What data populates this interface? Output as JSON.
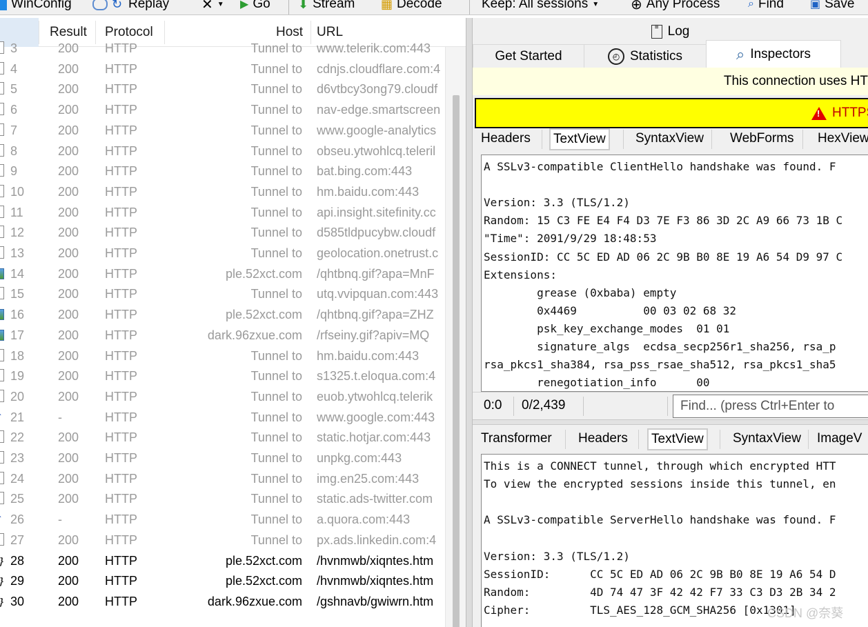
{
  "toolbar": {
    "winconfig": "WinConfig",
    "replay": "Replay",
    "go": "Go",
    "stream": "Stream",
    "decode": "Decode",
    "keep": "Keep: All sessions",
    "process": "Any Process",
    "find": "Find",
    "save": "Save"
  },
  "grid": {
    "headers": {
      "result": "Result",
      "protocol": "Protocol",
      "host": "Host",
      "url": "URL"
    },
    "rows": [
      {
        "icon": "doc",
        "num": "3",
        "result": "200",
        "protocol": "HTTP",
        "host": "Tunnel to",
        "url": "www.telerik.com:443",
        "dark": false
      },
      {
        "icon": "doc",
        "num": "4",
        "result": "200",
        "protocol": "HTTP",
        "host": "Tunnel to",
        "url": "cdnjs.cloudflare.com:4",
        "dark": false
      },
      {
        "icon": "doc",
        "num": "5",
        "result": "200",
        "protocol": "HTTP",
        "host": "Tunnel to",
        "url": "d6vtbcy3ong79.cloudf",
        "dark": false
      },
      {
        "icon": "doc",
        "num": "6",
        "result": "200",
        "protocol": "HTTP",
        "host": "Tunnel to",
        "url": "nav-edge.smartscreen",
        "dark": false
      },
      {
        "icon": "doc",
        "num": "7",
        "result": "200",
        "protocol": "HTTP",
        "host": "Tunnel to",
        "url": "www.google-analytics",
        "dark": false
      },
      {
        "icon": "doc",
        "num": "8",
        "result": "200",
        "protocol": "HTTP",
        "host": "Tunnel to",
        "url": "obseu.ytwohlcq.teleril",
        "dark": false
      },
      {
        "icon": "doc",
        "num": "9",
        "result": "200",
        "protocol": "HTTP",
        "host": "Tunnel to",
        "url": "bat.bing.com:443",
        "dark": false
      },
      {
        "icon": "doc",
        "num": "10",
        "result": "200",
        "protocol": "HTTP",
        "host": "Tunnel to",
        "url": "hm.baidu.com:443",
        "dark": false
      },
      {
        "icon": "doc",
        "num": "11",
        "result": "200",
        "protocol": "HTTP",
        "host": "Tunnel to",
        "url": "api.insight.sitefinity.cc",
        "dark": false
      },
      {
        "icon": "doc",
        "num": "12",
        "result": "200",
        "protocol": "HTTP",
        "host": "Tunnel to",
        "url": "d585tldpucybw.cloudf",
        "dark": false
      },
      {
        "icon": "doc",
        "num": "13",
        "result": "200",
        "protocol": "HTTP",
        "host": "Tunnel to",
        "url": "geolocation.onetrust.c",
        "dark": false
      },
      {
        "icon": "img",
        "num": "14",
        "result": "200",
        "protocol": "HTTP",
        "host": "ple.52xct.com",
        "url": "/qhtbnq.gif?apa=MnF",
        "dark": false
      },
      {
        "icon": "doc",
        "num": "15",
        "result": "200",
        "protocol": "HTTP",
        "host": "Tunnel to",
        "url": "utq.vvipquan.com:443",
        "dark": false
      },
      {
        "icon": "img",
        "num": "16",
        "result": "200",
        "protocol": "HTTP",
        "host": "ple.52xct.com",
        "url": "/qhtbnq.gif?apa=ZHZ",
        "dark": false
      },
      {
        "icon": "img",
        "num": "17",
        "result": "200",
        "protocol": "HTTP",
        "host": "dark.96zxue.com",
        "url": "/rfseiny.gif?apiv=MQ",
        "dark": false
      },
      {
        "icon": "doc",
        "num": "18",
        "result": "200",
        "protocol": "HTTP",
        "host": "Tunnel to",
        "url": "hm.baidu.com:443",
        "dark": false
      },
      {
        "icon": "doc",
        "num": "19",
        "result": "200",
        "protocol": "HTTP",
        "host": "Tunnel to",
        "url": "s1325.t.eloqua.com:4",
        "dark": false
      },
      {
        "icon": "doc",
        "num": "20",
        "result": "200",
        "protocol": "HTTP",
        "host": "Tunnel to",
        "url": "euob.ytwohlcq.telerik",
        "dark": false
      },
      {
        "icon": "up",
        "num": "21",
        "result": "-",
        "protocol": "HTTP",
        "host": "Tunnel to",
        "url": "www.google.com:443",
        "dark": false
      },
      {
        "icon": "doc",
        "num": "22",
        "result": "200",
        "protocol": "HTTP",
        "host": "Tunnel to",
        "url": "static.hotjar.com:443",
        "dark": false
      },
      {
        "icon": "doc",
        "num": "23",
        "result": "200",
        "protocol": "HTTP",
        "host": "Tunnel to",
        "url": "unpkg.com:443",
        "dark": false
      },
      {
        "icon": "doc",
        "num": "24",
        "result": "200",
        "protocol": "HTTP",
        "host": "Tunnel to",
        "url": "img.en25.com:443",
        "dark": false
      },
      {
        "icon": "doc",
        "num": "25",
        "result": "200",
        "protocol": "HTTP",
        "host": "Tunnel to",
        "url": "static.ads-twitter.com",
        "dark": false
      },
      {
        "icon": "up",
        "num": "26",
        "result": "-",
        "protocol": "HTTP",
        "host": "Tunnel to",
        "url": "a.quora.com:443",
        "dark": false
      },
      {
        "icon": "doc",
        "num": "27",
        "result": "200",
        "protocol": "HTTP",
        "host": "Tunnel to",
        "url": "px.ads.linkedin.com:4",
        "dark": false
      },
      {
        "icon": "js",
        "num": "28",
        "result": "200",
        "protocol": "HTTP",
        "host": "ple.52xct.com",
        "url": "/hvnmwb/xiqntes.htm",
        "dark": true
      },
      {
        "icon": "js",
        "num": "29",
        "result": "200",
        "protocol": "HTTP",
        "host": "ple.52xct.com",
        "url": "/hvnmwb/xiqntes.htm",
        "dark": true
      },
      {
        "icon": "js",
        "num": "30",
        "result": "200",
        "protocol": "HTTP",
        "host": "dark.96zxue.com",
        "url": "/gshnavb/gwiwrn.htm",
        "dark": true
      }
    ]
  },
  "right": {
    "tab_log": "Log",
    "tab_get_started": "Get Started",
    "tab_statistics": "Statistics",
    "tab_inspectors": "Inspectors",
    "notice": "This connection uses HT",
    "warning": "HTTPS",
    "request_tabs": [
      "Headers",
      "TextView",
      "SyntaxView",
      "WebForms",
      "HexView"
    ],
    "request_lines": [
      "A SSLv3-compatible ClientHello handshake was found. F",
      "",
      "Version: 3.3 (TLS/1.2)",
      "Random: 15 C3 FE E4 F4 D3 7E F3 86 3D 2C A9 66 73 1B C",
      "\"Time\": 2091/9/29 18:48:53",
      "SessionID: CC 5C ED AD 06 2C 9B B0 8E 19 A6 54 D9 97 C",
      "Extensions:",
      "        grease (0xbaba) empty",
      "        0x4469          00 03 02 68 32",
      "        psk_key_exchange_modes  01 01",
      "        signature_algs  ecdsa_secp256r1_sha256, rsa_p",
      "rsa_pkcs1_sha384, rsa_pss_rsae_sha512, rsa_pkcs1_sha5",
      "        renegotiation_info      00"
    ],
    "status_pos": "0:0",
    "status_size": "0/2,439",
    "find_placeholder": "Find... (press Ctrl+Enter to",
    "response_tabs": [
      "Transformer",
      "Headers",
      "TextView",
      "SyntaxView",
      "ImageV"
    ],
    "response_lines": [
      "This is a CONNECT tunnel, through which encrypted HTT",
      "To view the encrypted sessions inside this tunnel, en",
      "",
      "A SSLv3-compatible ServerHello handshake was found. F",
      "",
      "Version: 3.3 (TLS/1.2)",
      "SessionID:      CC 5C ED AD 06 2C 9B B0 8E 19 A6 54 D",
      "Random:         4D 74 47 3F 42 42 F7 33 C3 D3 2B 34 2",
      "Cipher:         TLS_AES_128_GCM_SHA256 [0x1301]"
    ]
  },
  "watermark": "CSDN @奈葵"
}
